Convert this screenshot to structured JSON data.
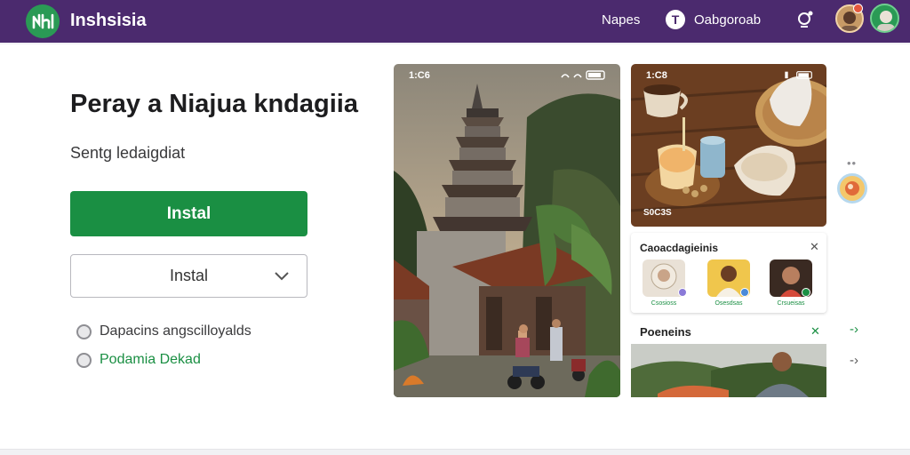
{
  "header": {
    "app_name": "Inshsisia",
    "nav_link": "Napes",
    "nav_icon_letter": "T",
    "nav_link2": "Oabgoroab",
    "icons": [
      "logo-icon",
      "notification-icon",
      "user-avatar",
      "account-avatar"
    ]
  },
  "hero": {
    "headline": "Peray a Niajua kndagiia",
    "subtitle": "Sentg ledaigdiat",
    "primary_button": "Instal",
    "secondary_button": "Instal",
    "features": [
      "Dapacins angscilloyalds",
      "Podamia Dekad"
    ]
  },
  "screens": {
    "screen1_time": "1:C6",
    "screen2_time": "1:C8",
    "screen2_stamp": "S0C3S"
  },
  "panel1": {
    "title": "Caoacdagieinis",
    "items": [
      "Csosioss",
      "Osesdsas",
      "Crsueisas"
    ]
  },
  "panel2": {
    "title": "Poeneins"
  },
  "side": {
    "dots": "••"
  },
  "colors": {
    "header_bg": "#4b2a6e",
    "primary": "#1a8f43",
    "accent_badge": "#e4573d"
  }
}
